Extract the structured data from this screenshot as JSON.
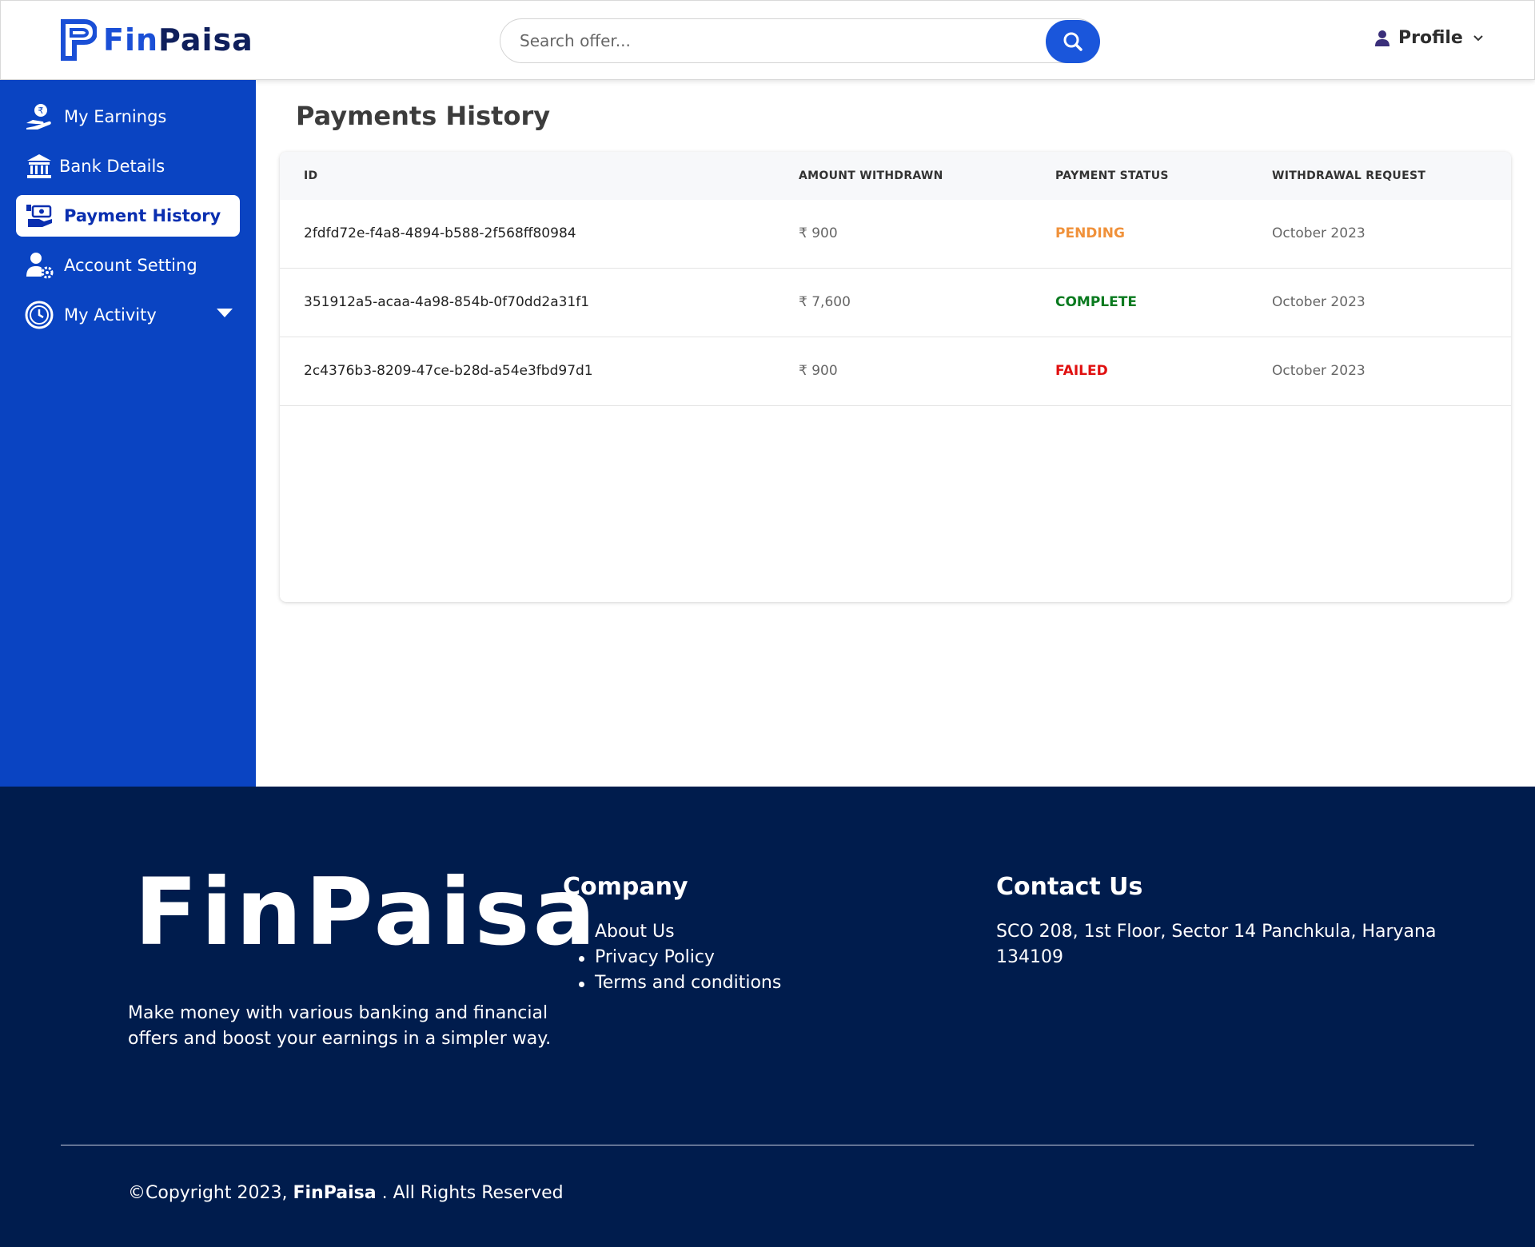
{
  "header": {
    "logo_fin": "Fin",
    "logo_paisa": "Paisa",
    "search_placeholder": "Search offer...",
    "profile_label": "Profile"
  },
  "sidebar": {
    "items": [
      {
        "label": "My Earnings",
        "icon": "hand-rupee-icon"
      },
      {
        "label": "Bank Details",
        "icon": "bank-icon"
      },
      {
        "label": "Payment History",
        "icon": "payment-exchange-icon",
        "active": true
      },
      {
        "label": "Account Setting",
        "icon": "user-gear-icon"
      },
      {
        "label": "My Activity",
        "icon": "clock-icon",
        "has_dropdown": true
      }
    ]
  },
  "main": {
    "title": "Payments History",
    "columns": [
      "ID",
      "AMOUNT WITHDRAWN",
      "PAYMENT STATUS",
      "WITHDRAWAL REQUEST"
    ],
    "rows": [
      {
        "id": "2fdfd72e-f4a8-4894-b588-2f568ff80984",
        "amount": "₹ 900",
        "status": "PENDING",
        "date": "October 2023"
      },
      {
        "id": "351912a5-acaa-4a98-854b-0f70dd2a31f1",
        "amount": "₹ 7,600",
        "status": "COMPLETE",
        "date": "October 2023"
      },
      {
        "id": "2c4376b3-8209-47ce-b28d-a54e3fbd97d1",
        "amount": "₹ 900",
        "status": "FAILED",
        "date": "October 2023"
      }
    ]
  },
  "footer": {
    "logo": "FinPaisa",
    "tagline": "Make money with various banking and financial offers and boost your earnings in a simpler way.",
    "company_heading": "Company",
    "company_links": [
      "About Us",
      "Privacy Policy",
      "Terms and conditions"
    ],
    "contact_heading": "Contact Us",
    "address": "SCO 208, 1st Floor, Sector 14 Panchkula, Haryana 134109",
    "copyright_prefix": "©Copyright 2023,",
    "copyright_brand": "FinPaisa",
    "copyright_suffix": ". All Rights Reserved"
  },
  "colors": {
    "brand_blue": "#1a4fd6",
    "sidebar_bg": "#0a44c2",
    "footer_bg": "#001c4d",
    "status_pending": "#f0913a",
    "status_complete": "#0a7a1f",
    "status_failed": "#e01010"
  }
}
